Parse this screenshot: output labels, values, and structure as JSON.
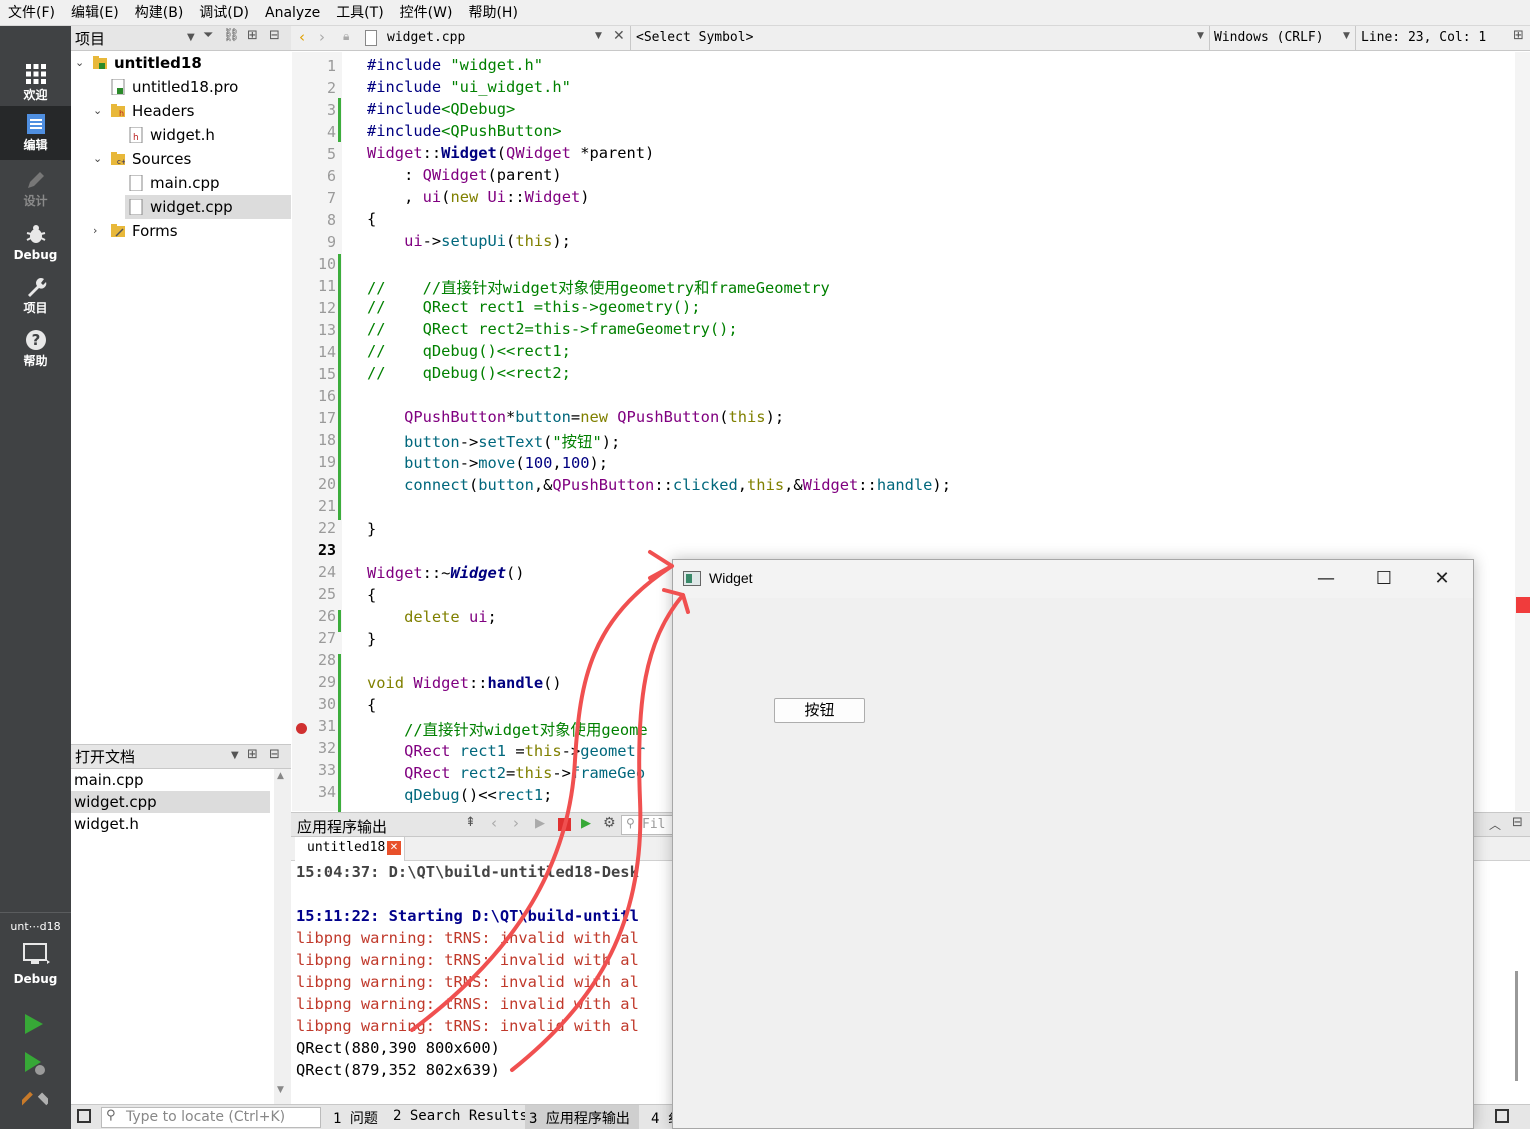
{
  "menubar": {
    "items": [
      "文件(F)",
      "编辑(E)",
      "构建(B)",
      "调试(D)",
      "Analyze",
      "工具(T)",
      "控件(W)",
      "帮助(H)"
    ]
  },
  "modes": {
    "welcome": "欢迎",
    "edit": "编辑",
    "design": "设计",
    "debug": "Debug",
    "projects": "项目",
    "help": "帮助",
    "kit_name": "unt⋯d18",
    "kit_mode": "Debug"
  },
  "project_pane": {
    "title": "项目",
    "root": "untitled18",
    "pro_file": "untitled18.pro",
    "headers": "Headers",
    "header_file": "widget.h",
    "sources": "Sources",
    "source_main": "main.cpp",
    "source_widget": "widget.cpp",
    "forms": "Forms"
  },
  "open_docs": {
    "title": "打开文档",
    "items": [
      "main.cpp",
      "widget.cpp",
      "widget.h"
    ]
  },
  "editor_bar": {
    "file": "widget.cpp",
    "symbol": "<Select Symbol>",
    "line_ending": "Windows (CRLF)",
    "position": "Line: 23, Col: 1"
  },
  "editor": {
    "current_line": 23,
    "line_numbers": [
      "1",
      "2",
      "3",
      "4",
      "5",
      "6",
      "7",
      "8",
      "9",
      "10",
      "11",
      "12",
      "13",
      "14",
      "15",
      "16",
      "17",
      "18",
      "19",
      "20",
      "21",
      "22",
      "23",
      "24",
      "25",
      "26",
      "27",
      "28",
      "29",
      "30",
      "31",
      "32",
      "33",
      "34"
    ],
    "code": {
      "l1": "#include \"widget.h\"",
      "l2": "#include \"ui_widget.h\"",
      "l3": "#include<QDebug>",
      "l4": "#include<QPushButton>",
      "l5": "Widget::Widget(QWidget *parent)",
      "l6": "    : QWidget(parent)",
      "l7": "    , ui(new Ui::Widget)",
      "l8": "{",
      "l9": "    ui->setupUi(this);",
      "l11": "//    //直接针对widget对象使用geometry和frameGeometry",
      "l12": "//    QRect rect1 =this->geometry();",
      "l13": "//    QRect rect2=this->frameGeometry();",
      "l14": "//    qDebug()<<rect1;",
      "l15": "//    qDebug()<<rect2;",
      "l17": "    QPushButton*button=new QPushButton(this);",
      "l18": "    button->setText(\"按钮\");",
      "l19": "    button->move(100,100);",
      "l20": "    connect(button,&QPushButton::clicked,this,&Widget::handle);",
      "l22": "}",
      "l24": "Widget::~Widget()",
      "l25": "{",
      "l26": "    delete ui;",
      "l27": "}",
      "l29": "void Widget::handle()",
      "l30": "{",
      "l31": "    //直接针对widget对象使用geome",
      "l32": "    QRect rect1 =this->geometr",
      "l33": "    QRect rect2=this->frameGeo",
      "l34": "    qDebug()<<rect1;"
    }
  },
  "output": {
    "title": "应用程序输出",
    "filter_placeholder": "Fil",
    "tab": "untitled18",
    "lines": [
      "15:04:37: D:\\QT\\build-untitled18-Desk",
      "15:11:22: Starting D:\\QT\\build-untitl",
      "libpng warning: tRNS: invalid with al",
      "libpng warning: tRNS: invalid with al",
      "libpng warning: tRNS: invalid with al",
      "libpng warning: tRNS: invalid with al",
      "libpng warning: tRNS: invalid with al",
      "QRect(880,390 800x600)",
      "QRect(879,352 802x639)"
    ]
  },
  "statusbar": {
    "locate_placeholder": "Type to locate (Ctrl+K)",
    "tabs": [
      "1 问题",
      "2 Search Results",
      "3 应用程序输出",
      "4 纟"
    ]
  },
  "widget_window": {
    "title": "Widget",
    "button_label": "按钮"
  },
  "colors": {
    "annotation_red": "#f05050",
    "modebar": "#404244"
  }
}
